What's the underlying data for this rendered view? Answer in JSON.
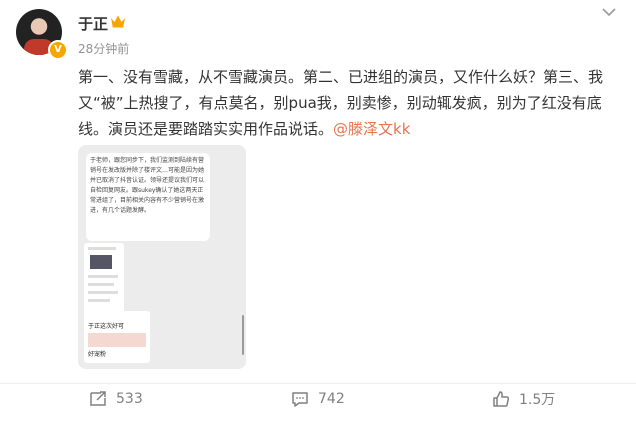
{
  "post": {
    "author": "于正",
    "timestamp": "28分钟前",
    "text_before_mention": "第一、没有雪藏，从不雪藏演员。第二、已进组的演员，又作什么妖？第三、我又“被”上热搜了，有点莫名，别pua我，别卖惨，别动辄发疯，别为了红没有底线。演员还是要踏踏实实用作品说话。",
    "mention": "@滕泽文kk"
  },
  "screenshot": {
    "message": "于老师，跟您同步下，我们监测到陆续有营销号在发改版并除了楼评文…可能是因为她并已取消了抖音认证。领导还提议我们可以自检回复网友。跟sukey确认了她这两天正常进组了，目前相关内容有不少营销号在激进，有几个话题发酵。",
    "mini_title": "于正这次好可",
    "mini_subtitle": "好宠粉"
  },
  "actions": {
    "repost_count": "533",
    "comment_count": "742",
    "like_count": "1.5万"
  },
  "colors": {
    "accent": "#eb7350",
    "muted": "#939393",
    "vip_gold": "#f7a600"
  },
  "icons": [
    "crown-icon",
    "verified-badge-icon",
    "more-chevron-icon",
    "repost-icon",
    "comment-icon",
    "like-icon"
  ]
}
